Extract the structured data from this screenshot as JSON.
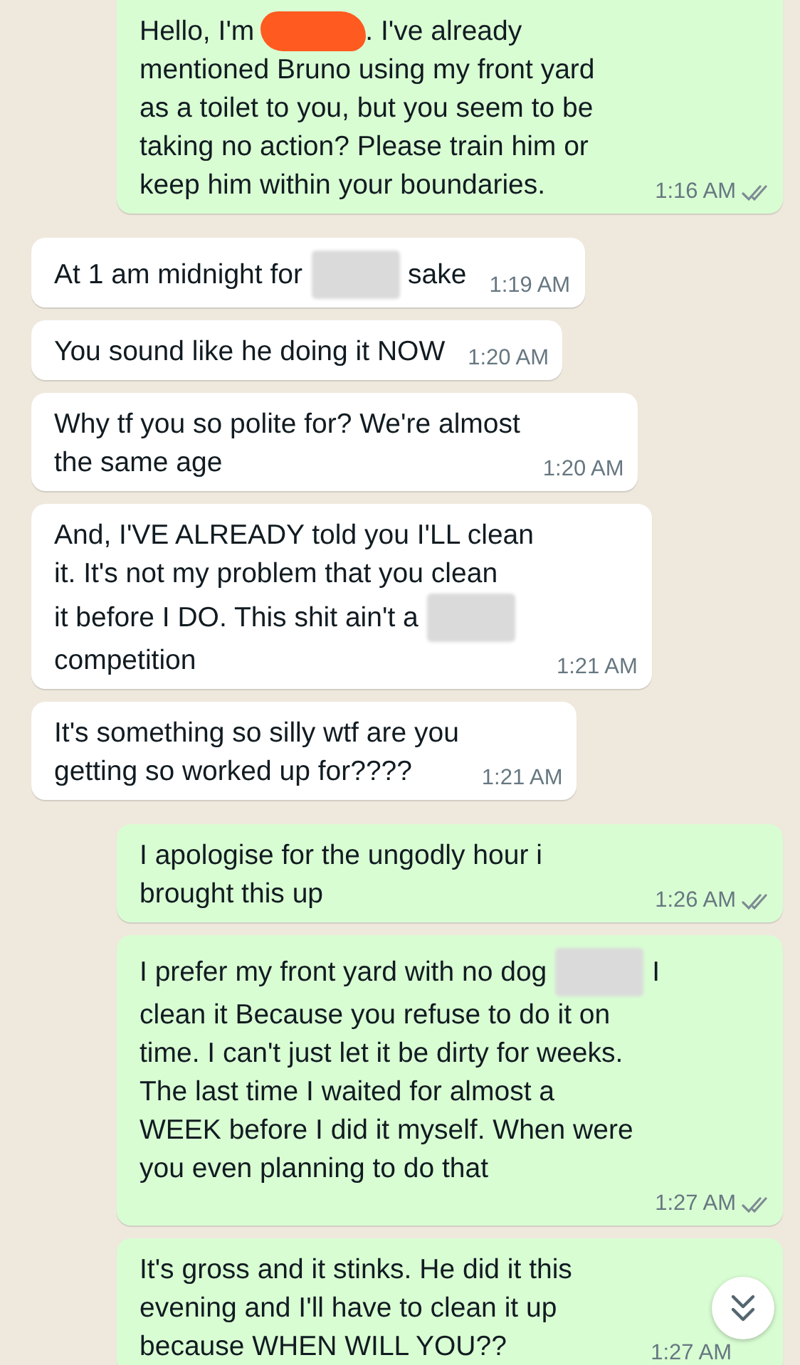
{
  "messages": [
    {
      "kind": "outgoing",
      "rows": [
        {
          "kind": "inline",
          "parts": [
            {
              "kind": "text",
              "text": "Hello, I'm"
            },
            {
              "kind": "scribble"
            },
            {
              "kind": "text",
              "text": ". I've already"
            }
          ]
        },
        {
          "kind": "text",
          "text": "mentioned Bruno using my front yard\nas a toilet to you, but you seem to be\ntaking no action? Please train him or\nkeep him within your boundaries."
        }
      ],
      "time": "1:16 AM",
      "delivered": true
    },
    {
      "kind": "incoming",
      "rows": [
        {
          "kind": "inline",
          "parts": [
            {
              "kind": "text",
              "text": "At 1 am midnight for"
            },
            {
              "kind": "blur"
            },
            {
              "kind": "text",
              "text": "sake"
            }
          ]
        }
      ],
      "time": "1:19 AM"
    },
    {
      "kind": "incoming",
      "rows": [
        {
          "kind": "text",
          "text": "You sound like he doing it NOW"
        }
      ],
      "time": "1:20 AM"
    },
    {
      "kind": "incoming",
      "rows": [
        {
          "kind": "text",
          "text": "Why tf you so polite for? We're almost\nthe same age"
        }
      ],
      "time": "1:20 AM"
    },
    {
      "kind": "incoming",
      "rows": [
        {
          "kind": "text",
          "text": "And, I'VE ALREADY told you I'LL clean\nit. It's not my problem that you clean"
        },
        {
          "kind": "inline",
          "parts": [
            {
              "kind": "text",
              "text": "it before I DO. This shit ain't a"
            },
            {
              "kind": "blur"
            }
          ]
        },
        {
          "kind": "text",
          "text": "competition"
        }
      ],
      "time": "1:21 AM"
    },
    {
      "kind": "incoming",
      "rows": [
        {
          "kind": "text",
          "text": "It's something so silly  wtf are you\ngetting so worked up for????"
        }
      ],
      "time": "1:21 AM"
    },
    {
      "kind": "outgoing",
      "rows": [
        {
          "kind": "text",
          "text": "I apologise for the ungodly hour i\nbrought this up"
        }
      ],
      "time": "1:26 AM",
      "delivered": true
    },
    {
      "kind": "outgoing",
      "rows": [
        {
          "kind": "inline",
          "parts": [
            {
              "kind": "text",
              "text": "I prefer my front yard with no dog"
            },
            {
              "kind": "blur"
            },
            {
              "kind": "text",
              "text": "I"
            }
          ]
        },
        {
          "kind": "text",
          "text": "clean it Because you refuse to do it on\ntime. I can't just let it be dirty for weeks.\nThe last time I waited for almost a\nWEEK before I did it myself. When were\nyou even planning to do that"
        }
      ],
      "time": "1:27 AM",
      "delivered": true
    },
    {
      "kind": "outgoing",
      "rows": [
        {
          "kind": "text",
          "text": "It's gross and it stinks. He did it this\nevening and I'll have to clean it up\nbecause WHEN WILL YOU??"
        }
      ],
      "time": "1:27 AM"
    }
  ]
}
